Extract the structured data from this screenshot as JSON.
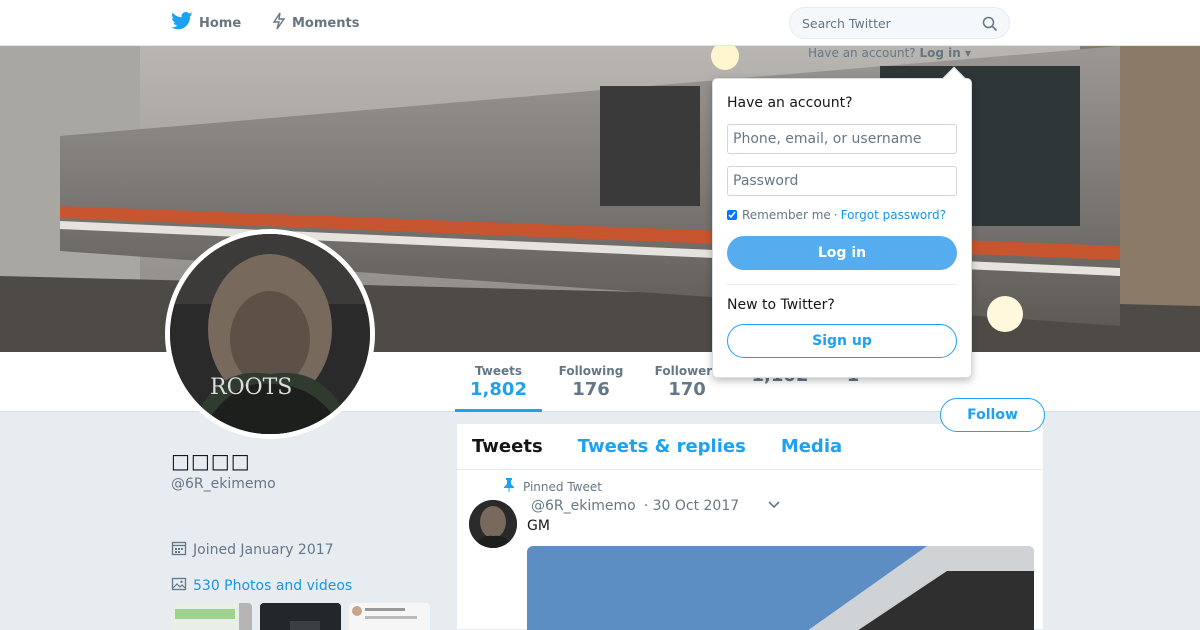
{
  "nav": {
    "home_label": "Home",
    "moments_label": "Moments",
    "search_placeholder": "Search Twitter"
  },
  "login_prompt": {
    "question": "Have an account?",
    "login_label": "Log in"
  },
  "dropdown": {
    "title": "Have an account?",
    "username_placeholder": "Phone, email, or username",
    "password_placeholder": "Password",
    "remember_label": "Remember me",
    "separator": "·",
    "forgot_label": "Forgot password?",
    "login_button": "Log in",
    "new_label": "New to Twitter?",
    "signup_button": "Sign up"
  },
  "stats": [
    {
      "label": "Tweets",
      "value": "1,802"
    },
    {
      "label": "Following",
      "value": "176"
    },
    {
      "label": "Followers",
      "value": "170"
    },
    {
      "label": "",
      "value": "1,102"
    },
    {
      "label": "",
      "value": "1"
    }
  ],
  "follow_button": "Follow",
  "profile": {
    "name": "□□□□",
    "handle": "@6R_ekimemo",
    "joined": "Joined January 2017",
    "photos": "530 Photos and videos"
  },
  "timeline": {
    "tabs": [
      "Tweets",
      "Tweets & replies",
      "Media"
    ],
    "pinned_label": "Pinned Tweet",
    "tweet": {
      "handle": "@6R_ekimemo",
      "date": "· 30 Oct 2017",
      "text": "GM"
    }
  },
  "colors": {
    "accent": "#1da1f2",
    "login_button": "#55acee",
    "background": "#e6ecf0"
  }
}
